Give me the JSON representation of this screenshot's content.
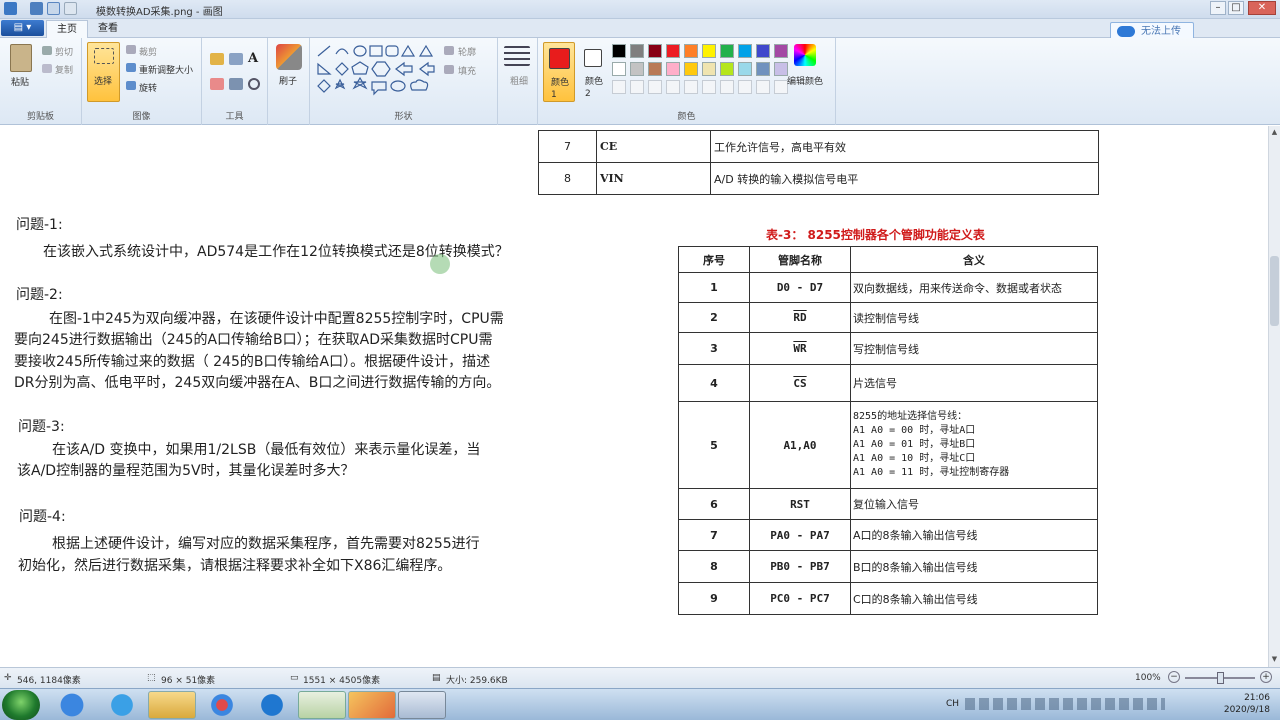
{
  "window": {
    "title": "模数转换AD采集.png - 画图",
    "min": "–",
    "max": "□",
    "close": "✕"
  },
  "tabs": {
    "file": "▤ ▾",
    "home": "主页",
    "view": "查看"
  },
  "upload": {
    "label": "无法上传"
  },
  "ribbon": {
    "clipboard": {
      "paste": "粘贴",
      "cut": "剪切",
      "copy": "复制",
      "group": "剪贴板"
    },
    "image": {
      "select": "选择",
      "crop": "裁剪",
      "resize": "重新调整大小",
      "rotate": "旋转",
      "group": "图像"
    },
    "tools": {
      "group": "工具"
    },
    "brushes": {
      "label": "刷子"
    },
    "shapes": {
      "outline": "轮廓",
      "fill": "填充",
      "group": "形状"
    },
    "size": {
      "label": "粗细"
    },
    "color1": {
      "label": "颜色 1",
      "value": "#e81c1c"
    },
    "color2": {
      "label": "颜色 2",
      "value": "#ffffff"
    },
    "editcolors": {
      "label": "编辑颜色"
    },
    "colors": {
      "group": "颜色"
    },
    "palette_row1": [
      "#000000",
      "#7f7f7f",
      "#880015",
      "#ed1c24",
      "#ff7f27",
      "#fff200",
      "#22b14c",
      "#00a2e8",
      "#3f48cc",
      "#a349a4"
    ],
    "palette_row2": [
      "#ffffff",
      "#c3c3c3",
      "#b97a57",
      "#ffaec9",
      "#ffc90e",
      "#efe4b0",
      "#b5e61d",
      "#99d9ea",
      "#7092be",
      "#c8bfe7"
    ]
  },
  "doc": {
    "table2": [
      {
        "no": "7",
        "pin": "CE",
        "desc": "工作允许信号，高电平有效"
      },
      {
        "no": "8",
        "pin": "VIN",
        "desc": "A/D 转换的输入模拟信号电平"
      }
    ],
    "q1": {
      "title": "问题-1:",
      "body": "在该嵌入式系统设计中，AD574是工作在12位转换模式还是8位转换模式？"
    },
    "q2": {
      "title": "问题-2:",
      "l1": "在图-1中245为双向缓冲器，在该硬件设计中配置8255控制字时，CPU需",
      "l2": "要向245进行数据输出（245的A口传输给B口）；在获取AD采集数据时CPU需",
      "l3": "要接收245所传输过来的数据（ 245的B口传输给A口）。根据硬件设计，描述",
      "l4": "DR分别为高、低电平时，245双向缓冲器在A、B口之间进行数据传输的方向。"
    },
    "q3": {
      "title": "问题-3:",
      "l1": "在该A/D 变换中，如果用1/2LSB（最低有效位）来表示量化误差，当",
      "l2": "该A/D控制器的量程范围为5V时，其量化误差时多大？"
    },
    "q4": {
      "title": "问题-4:",
      "l1": "根据上述硬件设计，编写对应的数据采集程序，首先需要对8255进行",
      "l2": "初始化，然后进行数据采集，请根据注释要求补全如下X86汇编程序。"
    },
    "table3": {
      "title": "表-3：   8255控制器各个管脚功能定义表",
      "headers": [
        "序号",
        "管脚名称",
        "含义"
      ],
      "rows": [
        {
          "no": "1",
          "pin": "D0 - D7",
          "desc": "双向数据线，用来传送命令、数据或者状态"
        },
        {
          "no": "2",
          "pin": "RD",
          "desc": "读控制信号线"
        },
        {
          "no": "3",
          "pin": "WR",
          "desc": "写控制信号线"
        },
        {
          "no": "4",
          "pin": "CS",
          "desc": "片选信号"
        },
        {
          "no": "5",
          "pin": "A1,A0",
          "desc": "8255的地址选择信号线：",
          "d2": "A1 A0 = 00 时，寻址A口",
          "d3": "A1 A0 = 01 时，寻址B口",
          "d4": "A1 A0 = 10 时，寻址C口",
          "d5": "A1 A0 = 11 时，寻址控制寄存器"
        },
        {
          "no": "6",
          "pin": "RST",
          "desc": "复位输入信号"
        },
        {
          "no": "7",
          "pin": "PA0 - PA7",
          "desc": "A口的8条输入输出信号线"
        },
        {
          "no": "8",
          "pin": "PB0 - PB7",
          "desc": "B口的8条输入输出信号线"
        },
        {
          "no": "9",
          "pin": "PC0 - PC7",
          "desc": "C口的8条输入输出信号线"
        }
      ]
    }
  },
  "status": {
    "cursor": "546, 1184像素",
    "selection": "96 × 51像素",
    "imgsize": "1551 × 4505像素",
    "filesize": "大小: 259.6KB",
    "zoom": "100%",
    "zoom_level": 1.0
  },
  "clock": {
    "time": "21:06",
    "date": "2020/9/18"
  },
  "tray": {
    "lang": "CH"
  }
}
